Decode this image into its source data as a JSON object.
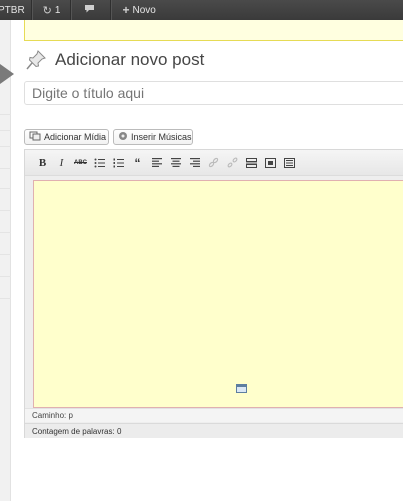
{
  "adminbar": {
    "site_label": "PTBR",
    "updates_count": "1",
    "updates_icon": "refresh-icon",
    "comments_icon": "speech-bubble-icon",
    "new_icon": "plus-icon",
    "new_label": "Novo"
  },
  "heading": {
    "icon": "pushpin-icon",
    "title": "Adicionar novo post"
  },
  "title_field": {
    "placeholder": "Digite o título aqui",
    "value": ""
  },
  "media_buttons": {
    "add_media": "Adicionar Mídia",
    "insert_music": "Inserir Músicas"
  },
  "toolbar": {
    "bold": "B",
    "italic": "I",
    "strikethrough": "ABC",
    "icons": [
      "bold-icon",
      "italic-icon",
      "strikethrough-icon",
      "bullet-list-icon",
      "numbered-list-icon",
      "blockquote-icon",
      "align-left-icon",
      "align-center-icon",
      "align-right-icon",
      "insert-link-icon",
      "remove-link-icon",
      "insert-more-icon",
      "fullscreen-icon",
      "kitchen-sink-icon"
    ]
  },
  "editor": {
    "path_label": "Caminho: p",
    "word_count_label": "Contagem de palavras: 0",
    "content_bg": "#ffffcc"
  },
  "colors": {
    "adminbar_bg": "#464646",
    "notice_bg": "#ffffe0",
    "notice_border": "#e6db55"
  }
}
